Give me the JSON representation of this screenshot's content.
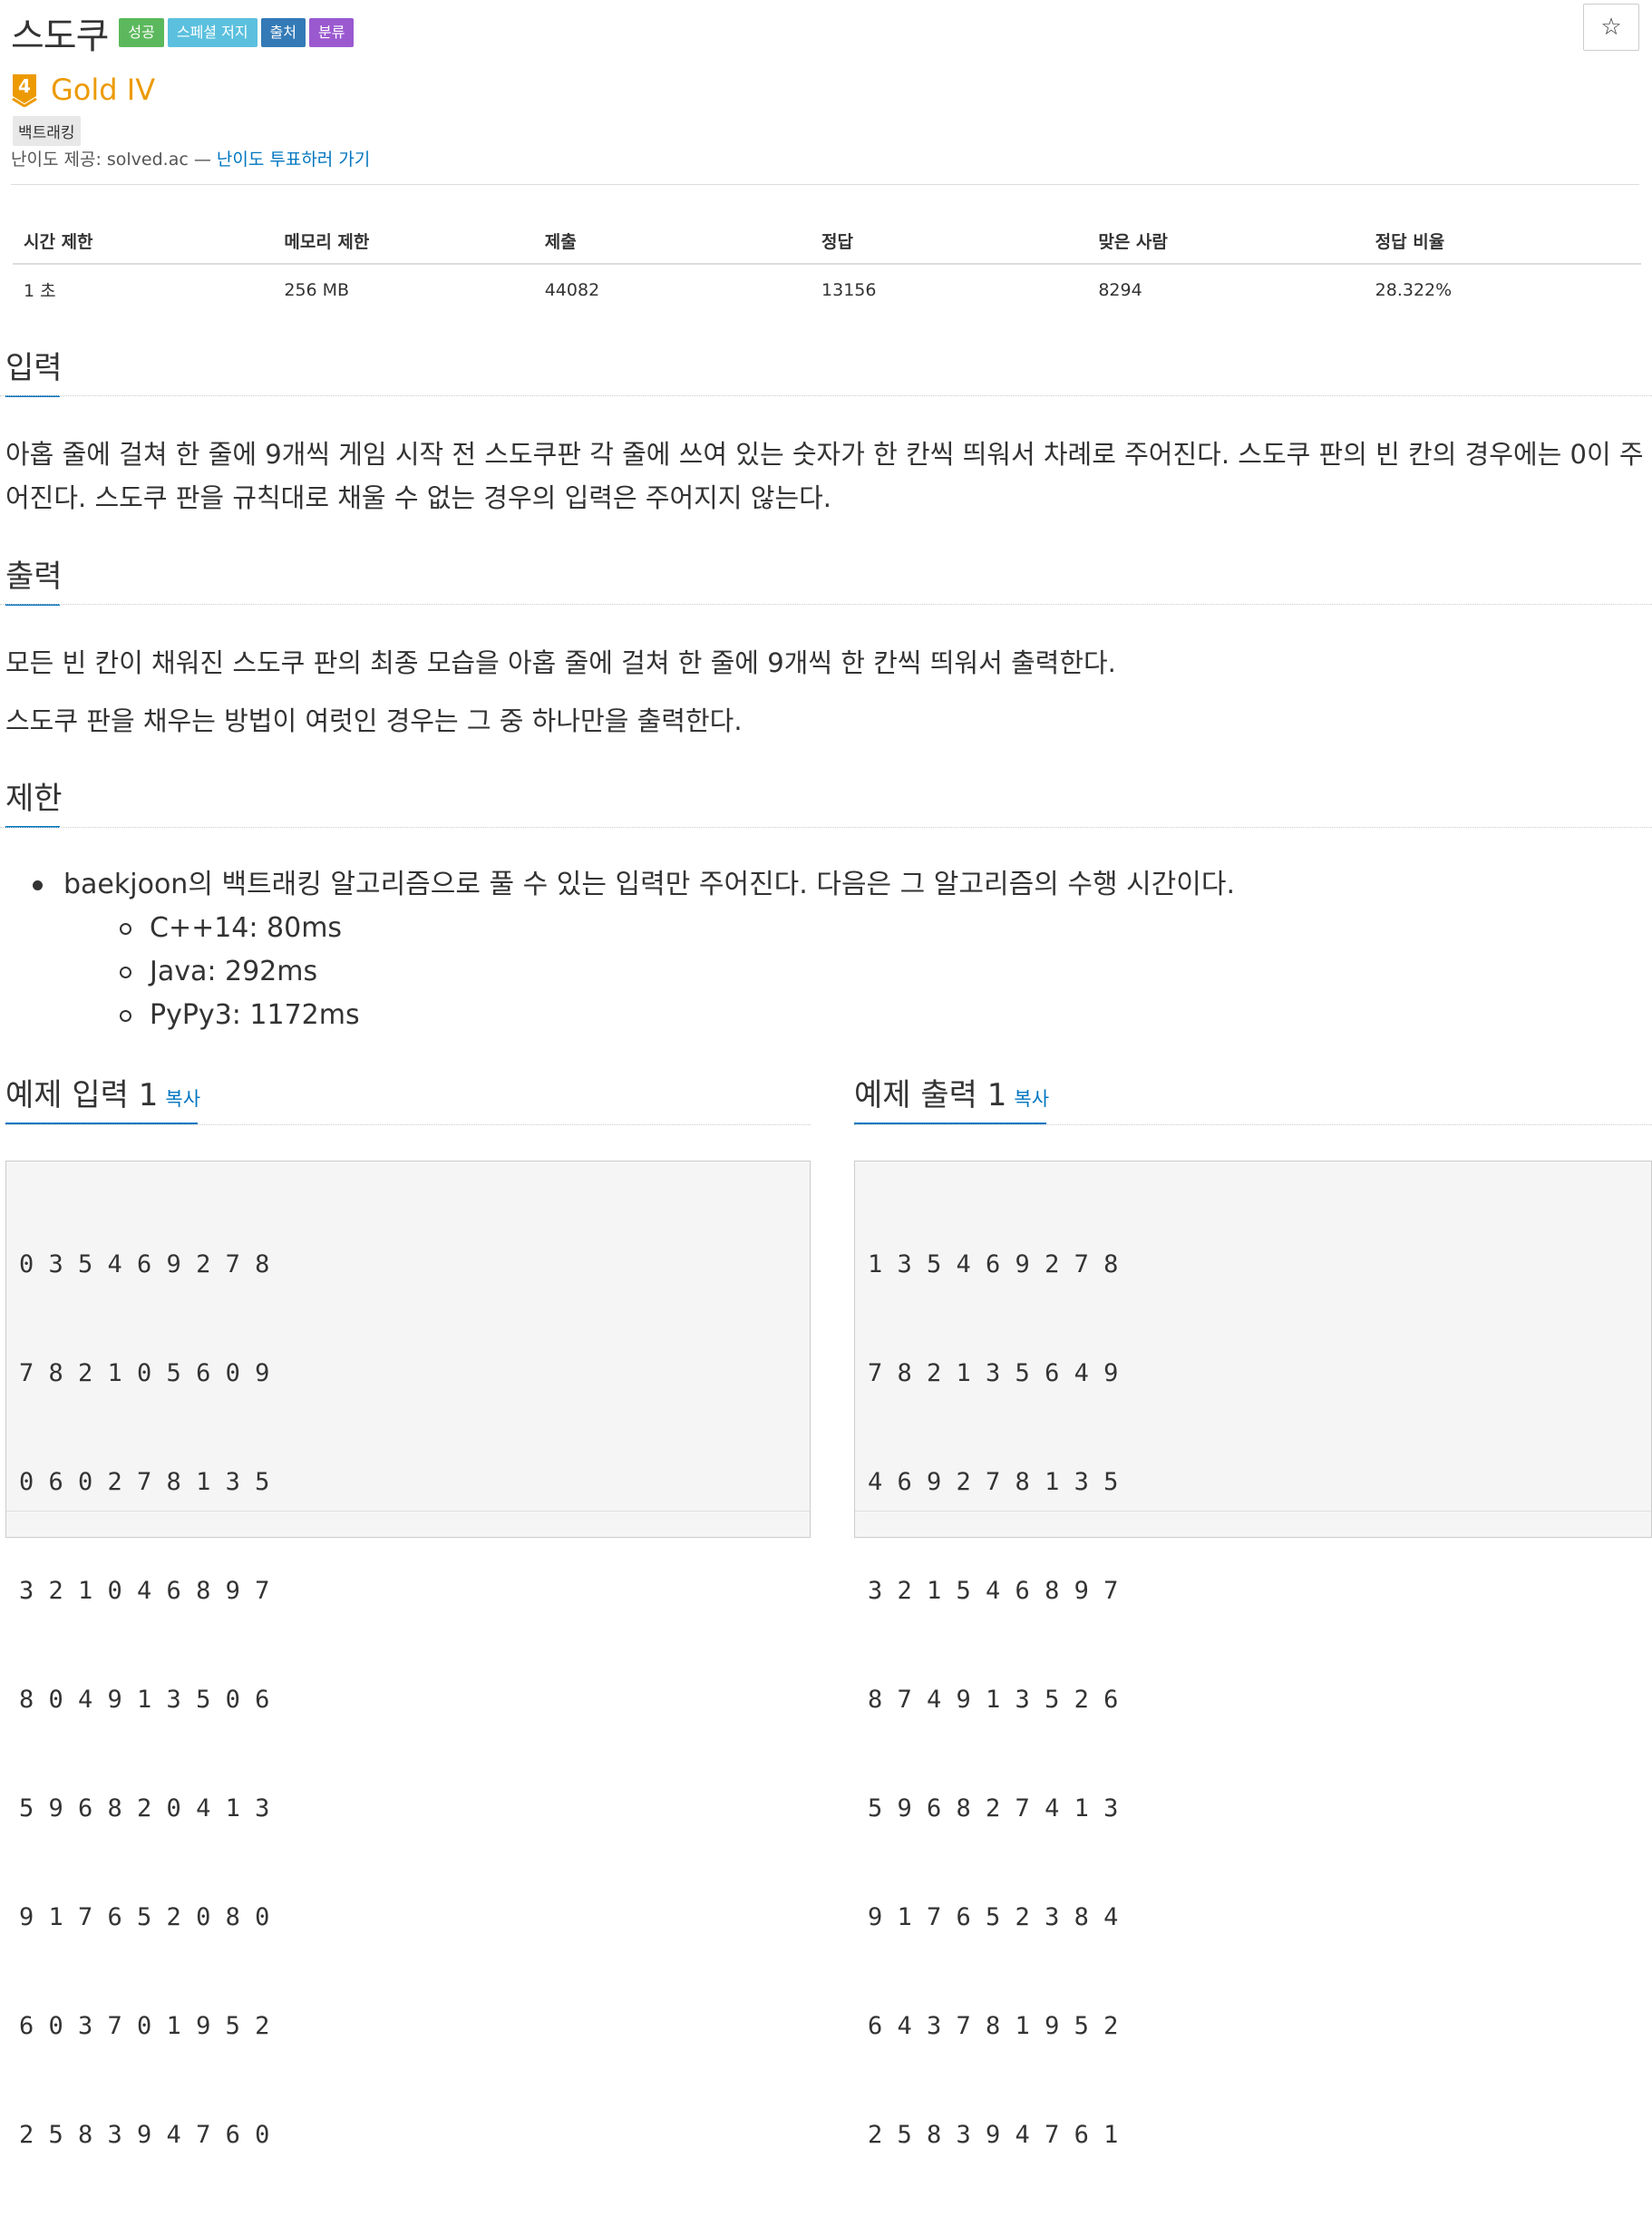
{
  "problem": {
    "title": "스도쿠",
    "labels": [
      {
        "text": "성공",
        "color": "#5cb85c"
      },
      {
        "text": "스페셜 저지",
        "color": "#5bc0de"
      },
      {
        "text": "출처",
        "color": "#337ab7"
      },
      {
        "text": "분류",
        "color": "#9b59d0"
      }
    ],
    "star_icon": "☆",
    "tier": {
      "badge": "4",
      "text": "Gold IV",
      "color": "#ec9a00"
    },
    "tag": "백트래킹",
    "provider_prefix": "난이도 제공: solved.ac — ",
    "provider_link": "난이도 투표하러 가기"
  },
  "info_table": {
    "headers": [
      "시간 제한",
      "메모리 제한",
      "제출",
      "정답",
      "맞은 사람",
      "정답 비율"
    ],
    "values": [
      "1 초",
      "256 MB",
      "44082",
      "13156",
      "8294",
      "28.322%"
    ]
  },
  "sections": {
    "input_title": "입력",
    "input_text": "아홉 줄에 걸쳐 한 줄에 9개씩 게임 시작 전 스도쿠판 각 줄에 쓰여 있는 숫자가 한 칸씩 띄워서 차례로 주어진다. 스도쿠 판의 빈 칸의 경우에는 0이 주어진다. 스도쿠 판을 규칙대로 채울 수 없는 경우의 입력은 주어지지 않는다.",
    "output_title": "출력",
    "output_text_1": "모든 빈 칸이 채워진 스도쿠 판의 최종 모습을 아홉 줄에 걸쳐 한 줄에 9개씩 한 칸씩 띄워서 출력한다.",
    "output_text_2": "스도쿠 판을 채우는 방법이 여럿인 경우는 그 중 하나만을 출력한다.",
    "limit_title": "제한",
    "limit_main": "baekjoon의 백트래킹 알고리즘으로 풀 수 있는 입력만 주어진다. 다음은 그 알고리즘의 수행 시간이다.",
    "limit_items": [
      "C++14: 80ms",
      "Java: 292ms",
      "PyPy3: 1172ms"
    ]
  },
  "samples": {
    "input_title": "예제 입력 1",
    "output_title": "예제 출력 1",
    "copy_label": "복사",
    "input_lines": [
      "0 3 5 4 6 9 2 7 8",
      "7 8 2 1 0 5 6 0 9",
      "0 6 0 2 7 8 1 3 5",
      "3 2 1 0 4 6 8 9 7",
      "8 0 4 9 1 3 5 0 6",
      "5 9 6 8 2 0 4 1 3",
      "9 1 7 6 5 2 0 8 0",
      "6 0 3 7 0 1 9 5 2",
      "2 5 8 3 9 4 7 6 0"
    ],
    "output_lines": [
      "1 3 5 4 6 9 2 7 8",
      "7 8 2 1 3 5 6 4 9",
      "4 6 9 2 7 8 1 3 5",
      "3 2 1 5 4 6 8 9 7",
      "8 7 4 9 1 3 5 2 6",
      "5 9 6 8 2 7 4 1 3",
      "9 1 7 6 5 2 3 8 4",
      "6 4 3 7 8 1 9 5 2",
      "2 5 8 3 9 4 7 6 1"
    ]
  }
}
